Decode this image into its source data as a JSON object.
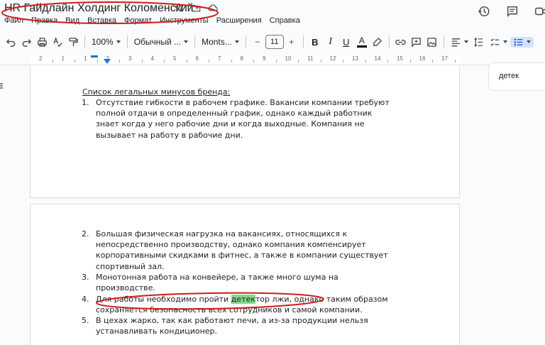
{
  "doc": {
    "title": "HR Гайдлайн Холдинг Коломенский"
  },
  "menu": [
    "Файл",
    "Правка",
    "Вид",
    "Вставка",
    "Формат",
    "Инструменты",
    "Расширения",
    "Справка"
  ],
  "toolbar": {
    "zoom": "100%",
    "style": "Обычный ...",
    "font": "Monts...",
    "font_size": "11",
    "minus": "−",
    "plus": "+",
    "bold": "B",
    "italic": "I",
    "underline": "U",
    "text_color": "A"
  },
  "ruler": {
    "numbers": [
      "2",
      "1",
      "1",
      "2",
      "3",
      "4",
      "5",
      "6",
      "7",
      "8",
      "9",
      "10",
      "11",
      "12",
      "13",
      "14",
      "15",
      "16",
      "17"
    ]
  },
  "content": {
    "heading": "Список легальных минусов бренда:",
    "items": [
      {
        "num": "1.",
        "lines": [
          "Отсутствие гибкости в рабочем графике. Вакансии компании требуют",
          "полной отдачи в определенный график, однако каждый работник",
          "знает когда у него рабочие дни и когда выходные. Компания не",
          "вызывает на работу в рабочие дни."
        ]
      },
      {
        "num": "2.",
        "lines": [
          "Большая физическая нагрузка на вакансиях, относящихся к",
          "непосредственно производству, однако компания компенсирует",
          "корпоративными скидками в фитнес, а также в компании существует",
          "спортивный зал."
        ]
      },
      {
        "num": "3.",
        "lines": [
          "Монотонная работа на конвейере, а также много шума на",
          "производстве."
        ]
      },
      {
        "num": "4.",
        "line1_before": "Для работы необходимо пройти ",
        "line1_highlight": "детек",
        "line1_after": "тор лжи, однако таким образом",
        "line2": "сохраняется безопасность всех сотрудников и самой компании."
      },
      {
        "num": "5.",
        "lines": [
          "В цехах жарко, так как работают печи, а из-за продукции нельзя",
          "устанавливать кондиционер."
        ]
      }
    ]
  },
  "search": {
    "value": "детек"
  },
  "colors": {
    "highlight": "#7fdb8a",
    "annotation": "#d11a1a",
    "list_active": "#d3e3fd"
  }
}
